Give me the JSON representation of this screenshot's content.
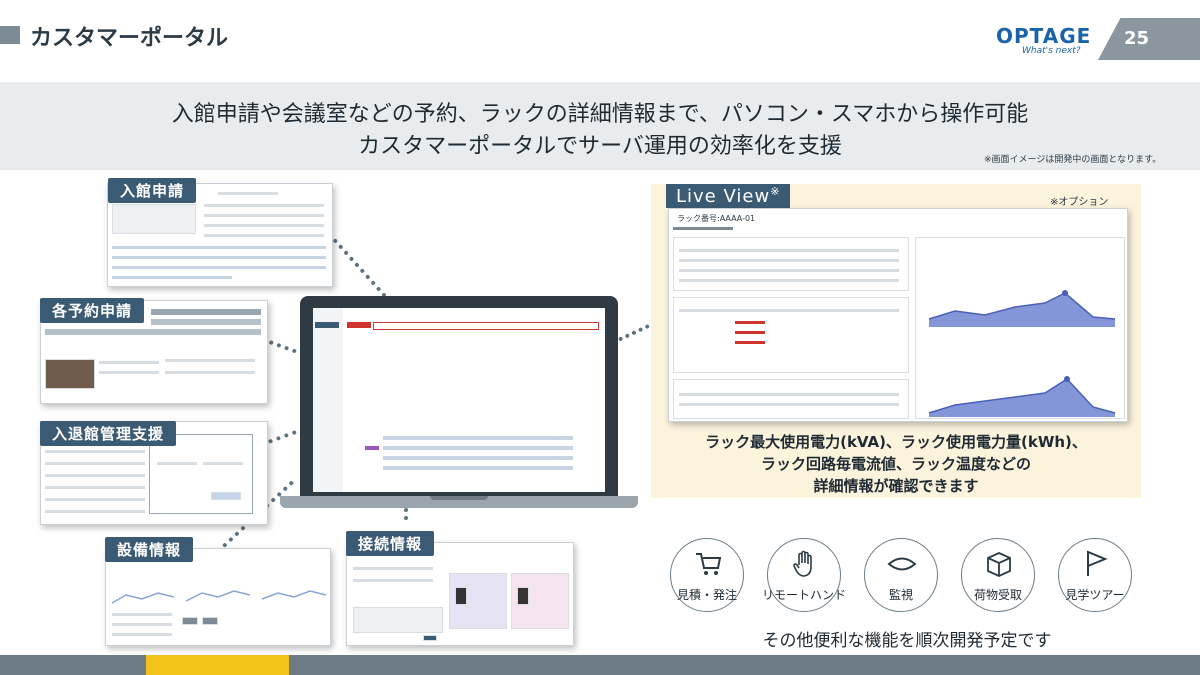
{
  "header": {
    "title": "カスタマーポータル",
    "logo_text": "OPTAGE",
    "logo_tagline": "What's next?",
    "page_number": "25"
  },
  "banner": {
    "line1": "入館申請や会議室などの予約、ラックの詳細情報まで、パソコン・スマホから操作可能",
    "line2": "カスタマーポータルでサーバ運用の効率化を支援",
    "note": "※画面イメージは開発中の画面となります。"
  },
  "screens": {
    "entry_request": "入館申請",
    "reservations": "各予約申請",
    "entry_management": "入退館管理支援",
    "equipment": "設備情報",
    "connection": "接続情報"
  },
  "live_view": {
    "title": "Live View",
    "title_mark": "※",
    "option_note": "※オプション",
    "rack_number": "ラック番号:AAAA-01",
    "desc_line1": "ラック最大使用電力(kVA)、ラック使用電力量(kWh)、",
    "desc_line2": "ラック回路毎電流値、ラック温度などの",
    "desc_line3": "詳細情報が確認できます"
  },
  "features": [
    {
      "label": "見積・発注",
      "icon": "cart-icon"
    },
    {
      "label": "リモートハンド",
      "icon": "hand-icon"
    },
    {
      "label": "監視",
      "icon": "eye-icon"
    },
    {
      "label": "荷物受取",
      "icon": "box-icon"
    },
    {
      "label": "見学ツアー",
      "icon": "flag-icon"
    }
  ],
  "future_note": "その他便利な機能を順次開発予定です",
  "colors": {
    "accent_navy": "#3b5a73",
    "brand_blue": "#1a63a8",
    "footer_grey": "#6c7b86",
    "footer_yellow": "#f2c21a",
    "liveview_bg": "#fbf3dc"
  }
}
